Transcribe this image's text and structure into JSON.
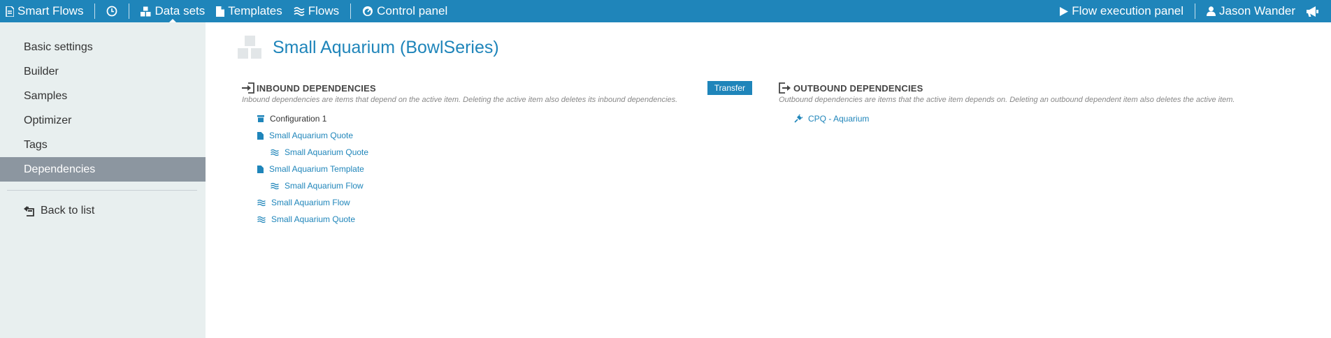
{
  "topbar": {
    "brand": "Smart Flows",
    "nav": [
      {
        "label": "Data sets",
        "icon": "data-sets-icon",
        "active": true
      },
      {
        "label": "Templates",
        "icon": "document-icon"
      },
      {
        "label": "Flows",
        "icon": "flow-icon"
      },
      {
        "label": "Control panel",
        "icon": "gauge-icon"
      }
    ],
    "flow_execution": "Flow execution panel",
    "user": "Jason Wander"
  },
  "sidebar": {
    "items": [
      {
        "label": "Basic settings"
      },
      {
        "label": "Builder"
      },
      {
        "label": "Samples"
      },
      {
        "label": "Optimizer"
      },
      {
        "label": "Tags"
      },
      {
        "label": "Dependencies",
        "active": true
      }
    ],
    "back": "Back to list"
  },
  "page": {
    "title": "Small Aquarium (BowlSeries)"
  },
  "inbound": {
    "title": "INBOUND DEPENDENCIES",
    "transfer": "Transfer",
    "description": "Inbound dependencies are items that depend on the active item. Deleting the active item also deletes its inbound dependencies.",
    "items": [
      {
        "label": "Configuration 1",
        "icon": "archive-icon",
        "level": 1,
        "link": false
      },
      {
        "label": "Small Aquarium Quote",
        "icon": "document-icon",
        "level": 1,
        "link": true
      },
      {
        "label": "Small Aquarium Quote",
        "icon": "flow-icon",
        "level": 2,
        "link": true
      },
      {
        "label": "Small Aquarium Template",
        "icon": "document-icon",
        "level": 1,
        "link": true
      },
      {
        "label": "Small Aquarium Flow",
        "icon": "flow-icon",
        "level": 2,
        "link": true
      },
      {
        "label": "Small Aquarium Flow",
        "icon": "flow-icon",
        "level": 1,
        "link": true
      },
      {
        "label": "Small Aquarium Quote",
        "icon": "flow-icon",
        "level": 1,
        "link": true
      }
    ]
  },
  "outbound": {
    "title": "OUTBOUND DEPENDENCIES",
    "description": "Outbound dependencies are items that the active item depends on. Deleting an outbound dependent item also deletes the active item.",
    "items": [
      {
        "label": "CPQ - Aquarium",
        "icon": "plug-icon",
        "level": 1,
        "link": true
      }
    ]
  },
  "colors": {
    "accent": "#1f85ba",
    "sidebar_bg": "#e8efef",
    "sidebar_active": "#8c96a0"
  }
}
